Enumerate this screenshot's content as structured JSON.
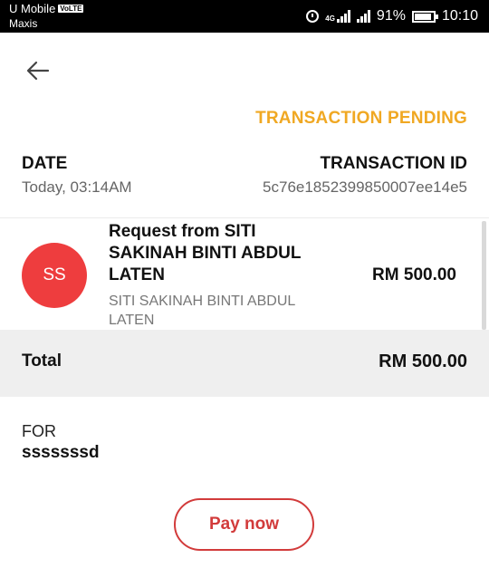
{
  "statusbar": {
    "carrier1": "U Mobile",
    "volte_badge": "VoLTE",
    "carrier2": "Maxis",
    "net_label": "4G",
    "battery": "91%",
    "battery_level": 0.91,
    "time": "10:10"
  },
  "header": {
    "status": "TRANSACTION PENDING"
  },
  "details": {
    "date_label": "DATE",
    "date_value": "Today, 03:14AM",
    "txid_label": "TRANSACTION ID",
    "txid_value": "5c76e1852399850007ee14e5"
  },
  "request": {
    "avatar_initials": "SS",
    "avatar_color": "#ee3d3e",
    "title": "Request from SITI SAKINAH BINTI ABDUL LATEN",
    "subtitle": "SITI SAKINAH BINTI ABDUL LATEN",
    "amount": "RM 500.00"
  },
  "total": {
    "label": "Total",
    "value": "RM 500.00"
  },
  "note": {
    "label": "FOR",
    "value": "sssssssd"
  },
  "actions": {
    "pay_label": "Pay now"
  },
  "colors": {
    "pending": "#f0a823",
    "accent": "#d23b3b"
  }
}
